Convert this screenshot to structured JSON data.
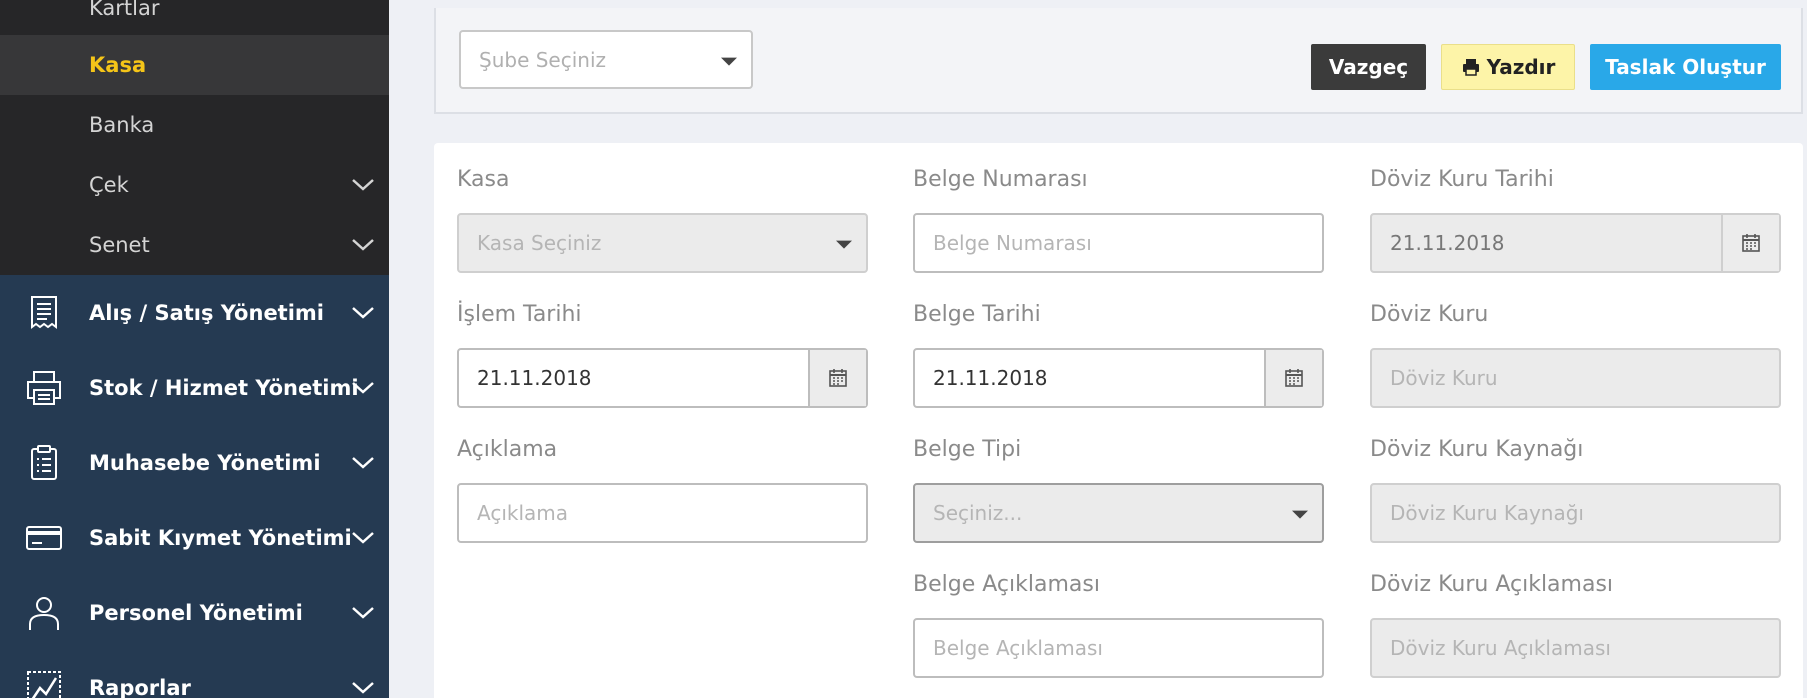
{
  "sidebar": {
    "sub_items": [
      {
        "label": "Kartlar"
      },
      {
        "label": "Kasa"
      },
      {
        "label": "Banka"
      },
      {
        "label": "Çek"
      },
      {
        "label": "Senet"
      }
    ],
    "menu": [
      {
        "label": "Alış / Satış Yönetimi",
        "icon": "receipt-icon"
      },
      {
        "label": "Stok / Hizmet Yönetimi",
        "icon": "printer-stock-icon"
      },
      {
        "label": "Muhasebe Yönetimi",
        "icon": "clipboard-icon"
      },
      {
        "label": "Sabit Kıymet Yönetimi",
        "icon": "credit-card-icon"
      },
      {
        "label": "Personel Yönetimi",
        "icon": "person-icon"
      },
      {
        "label": "Raporlar",
        "icon": "chart-icon"
      }
    ]
  },
  "toolbar": {
    "branch_placeholder": "Şube Seçiniz",
    "cancel_label": "Vazgeç",
    "print_label": "Yazdır",
    "draft_label": "Taslak Oluştur"
  },
  "form": {
    "kasa": {
      "label": "Kasa",
      "placeholder": "Kasa Seçiniz"
    },
    "islem_tarihi": {
      "label": "İşlem Tarihi",
      "value": "21.11.2018"
    },
    "aciklama": {
      "label": "Açıklama",
      "placeholder": "Açıklama"
    },
    "belge_numarasi": {
      "label": "Belge Numarası",
      "placeholder": "Belge Numarası"
    },
    "belge_tarihi": {
      "label": "Belge Tarihi",
      "value": "21.11.2018"
    },
    "belge_tipi": {
      "label": "Belge Tipi",
      "placeholder": "Seçiniz..."
    },
    "belge_aciklamasi": {
      "label": "Belge Açıklaması",
      "placeholder": "Belge Açıklaması"
    },
    "doviz_kuru_tarihi": {
      "label": "Döviz Kuru Tarihi",
      "value": "21.11.2018"
    },
    "doviz_kuru": {
      "label": "Döviz Kuru",
      "placeholder": "Döviz Kuru"
    },
    "doviz_kuru_kaynagi": {
      "label": "Döviz Kuru Kaynağı",
      "placeholder": "Döviz Kuru Kaynağı"
    },
    "doviz_kuru_aciklamasi": {
      "label": "Döviz Kuru Açıklaması",
      "placeholder": "Döviz Kuru Açıklaması"
    }
  },
  "colors": {
    "sidebar_bg": "#253a52",
    "submenu_bg": "#262628",
    "active_text": "#f5c518",
    "draft_button": "#29a8e8",
    "print_button": "#fdf4a8",
    "cancel_button": "#3b3b3b"
  }
}
